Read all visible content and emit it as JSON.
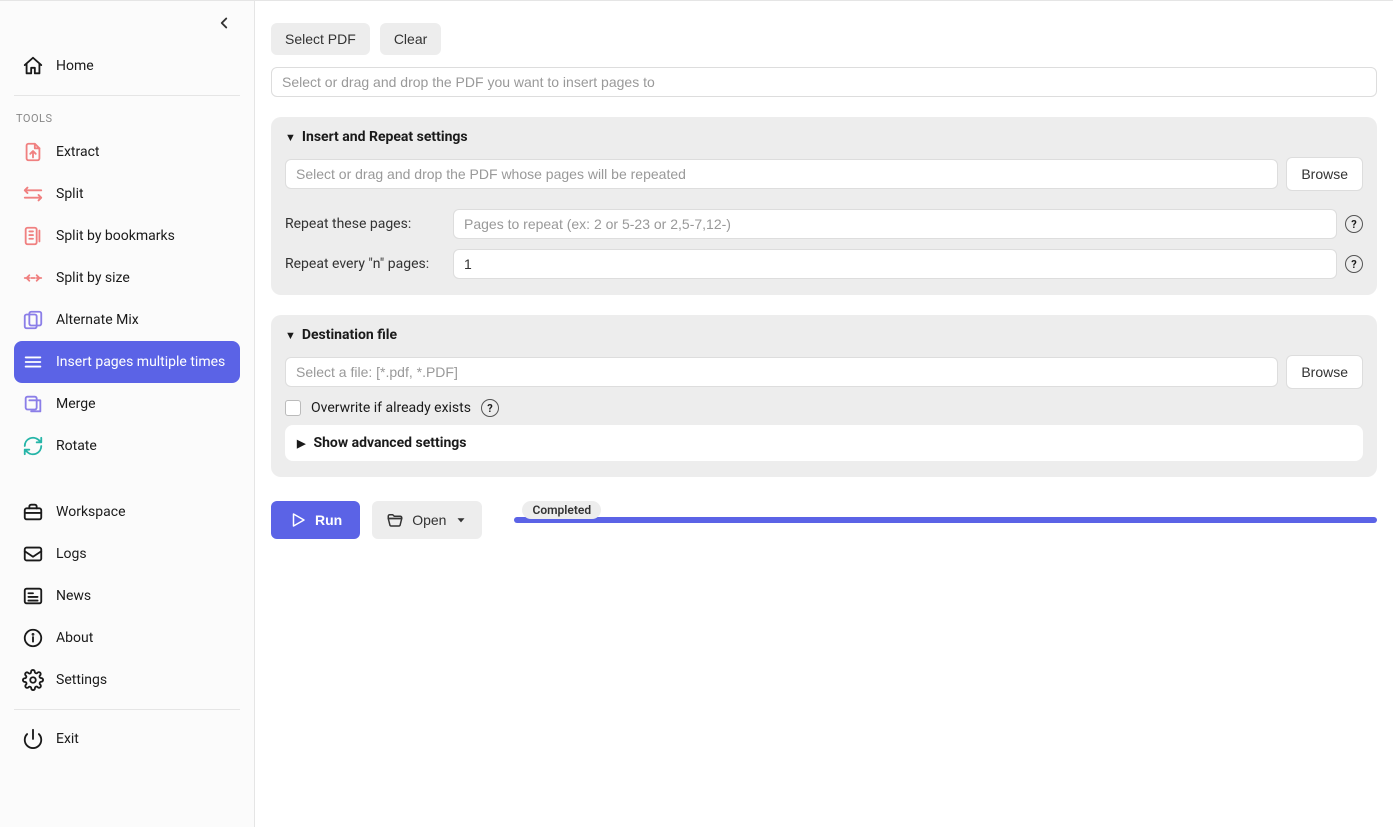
{
  "sidebar": {
    "home": "Home",
    "tools_label": "TOOLS",
    "tools": [
      {
        "label": "Extract"
      },
      {
        "label": "Split"
      },
      {
        "label": "Split by bookmarks"
      },
      {
        "label": "Split by size"
      },
      {
        "label": "Alternate Mix"
      },
      {
        "label": "Insert pages multiple times"
      },
      {
        "label": "Merge"
      },
      {
        "label": "Rotate"
      }
    ],
    "workspace": "Workspace",
    "logs": "Logs",
    "news": "News",
    "about": "About",
    "settings": "Settings",
    "exit": "Exit"
  },
  "toolbar": {
    "select_pdf": "Select PDF",
    "clear": "Clear"
  },
  "target_pdf_placeholder": "Select or drag and drop the PDF you want to insert pages to",
  "panel_insert": {
    "title": "Insert and Repeat settings",
    "source_placeholder": "Select or drag and drop the PDF whose pages will be repeated",
    "browse": "Browse",
    "repeat_pages_label": "Repeat these pages:",
    "repeat_pages_placeholder": "Pages to repeat (ex: 2 or 5-23 or 2,5-7,12-)",
    "repeat_every_label": "Repeat every \"n\" pages:",
    "repeat_every_value": "1"
  },
  "panel_dest": {
    "title": "Destination file",
    "file_placeholder": "Select a file: [*.pdf, *.PDF]",
    "browse": "Browse",
    "overwrite_label": "Overwrite if already exists",
    "advanced_label": "Show advanced settings"
  },
  "actions": {
    "run": "Run",
    "open": "Open",
    "status": "Completed"
  }
}
